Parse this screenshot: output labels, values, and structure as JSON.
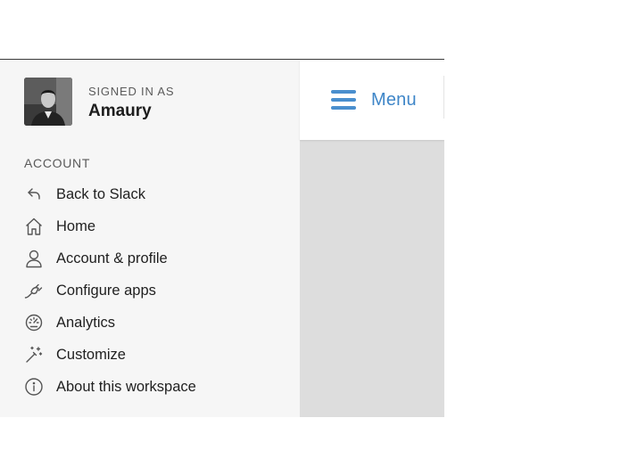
{
  "profile": {
    "signed_in_label": "SIGNED IN AS",
    "name": "Amaury"
  },
  "account": {
    "section_label": "ACCOUNT",
    "items": [
      {
        "label": "Back to Slack",
        "icon": "reply-arrow-icon"
      },
      {
        "label": "Home",
        "icon": "home-icon"
      },
      {
        "label": "Account & profile",
        "icon": "user-icon"
      },
      {
        "label": "Configure apps",
        "icon": "plug-icon"
      },
      {
        "label": "Analytics",
        "icon": "gauge-icon"
      },
      {
        "label": "Customize",
        "icon": "magic-wand-icon"
      },
      {
        "label": "About this workspace",
        "icon": "info-icon"
      }
    ]
  },
  "menu": {
    "label": "Menu"
  },
  "colors": {
    "accent": "#3f86c8",
    "drawer_bg": "#f6f6f6",
    "content_bg": "#dddddd"
  }
}
